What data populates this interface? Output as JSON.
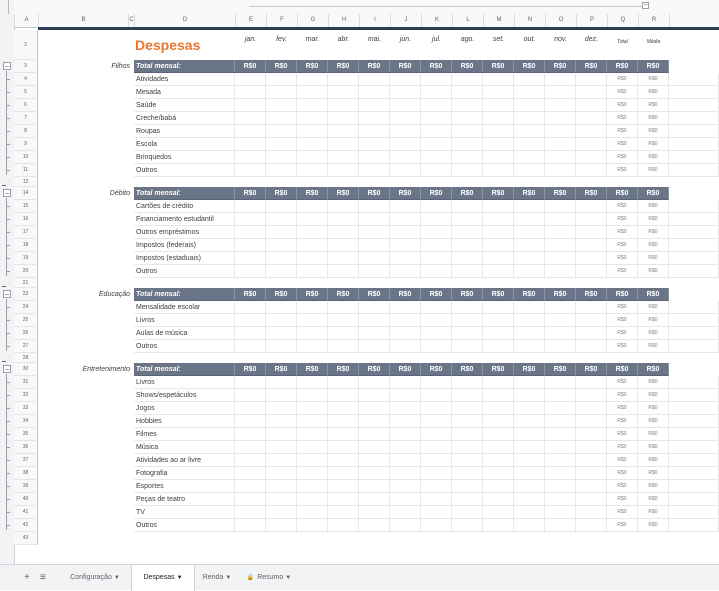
{
  "title": "Despesas",
  "column_letters": [
    "A",
    "B",
    "C",
    "D",
    "E",
    "F",
    "G",
    "H",
    "I",
    "J",
    "K",
    "L",
    "M",
    "N",
    "O",
    "P",
    "Q",
    "R"
  ],
  "months": [
    "jan.",
    "fev.",
    "mar.",
    "abr.",
    "mai.",
    "jun.",
    "jul.",
    "ago.",
    "set.",
    "out.",
    "nov.",
    "dez."
  ],
  "total_header": "Total",
  "avg_header": "Média",
  "total_row_label": "Total mensal:",
  "currency_zero": "R$0",
  "sections": [
    {
      "name": "Filhos",
      "total_row": "3",
      "rows": [
        [
          "4",
          "Atividades"
        ],
        [
          "5",
          "Mesada"
        ],
        [
          "6",
          "Saúde"
        ],
        [
          "7",
          "Creche/babá"
        ],
        [
          "8",
          "Roupas"
        ],
        [
          "9",
          "Escola"
        ],
        [
          "10",
          "Brinquedos"
        ],
        [
          "11",
          "Outros"
        ]
      ],
      "spacer": "12"
    },
    {
      "name": "Débito",
      "total_row": "14",
      "rows": [
        [
          "15",
          "Cartões de crédito"
        ],
        [
          "16",
          "Financiamento estudantil"
        ],
        [
          "17",
          "Outros empréstimos"
        ],
        [
          "18",
          "Impostos (federais)"
        ],
        [
          "19",
          "Impostos (estaduais)"
        ],
        [
          "20",
          "Outros"
        ]
      ],
      "spacer": "21"
    },
    {
      "name": "Educação",
      "total_row": "23",
      "rows": [
        [
          "24",
          "Mensalidade escolar"
        ],
        [
          "25",
          "Livros"
        ],
        [
          "26",
          "Aulas de música"
        ],
        [
          "27",
          "Outros"
        ]
      ],
      "spacer": "28"
    },
    {
      "name": "Entretenimento",
      "total_row": "30",
      "rows": [
        [
          "31",
          "Livros"
        ],
        [
          "32",
          "Shows/espetáculos"
        ],
        [
          "33",
          "Jogos"
        ],
        [
          "34",
          "Hobbies"
        ],
        [
          "35",
          "Filmes"
        ],
        [
          "36",
          "Música"
        ],
        [
          "37",
          "Atividades ao ar livre"
        ],
        [
          "38",
          "Fotografia"
        ],
        [
          "39",
          "Esportes"
        ],
        [
          "40",
          "Peças de teatro"
        ],
        [
          "41",
          "TV"
        ],
        [
          "42",
          "Outros"
        ]
      ],
      "spacer": "43"
    }
  ],
  "header_row_num": "2",
  "footer": {
    "add": "+",
    "menu": "≡",
    "tabs": [
      {
        "label": "Configuração",
        "active": false,
        "locked": false
      },
      {
        "label": "Despesas",
        "active": true,
        "locked": false
      },
      {
        "label": "Renda",
        "active": false,
        "locked": false
      },
      {
        "label": "Resumo",
        "active": false,
        "locked": true
      }
    ]
  },
  "colors": {
    "accent": "#e8772e",
    "total_bg": "#6b7588",
    "navy": "#2e3e54"
  }
}
